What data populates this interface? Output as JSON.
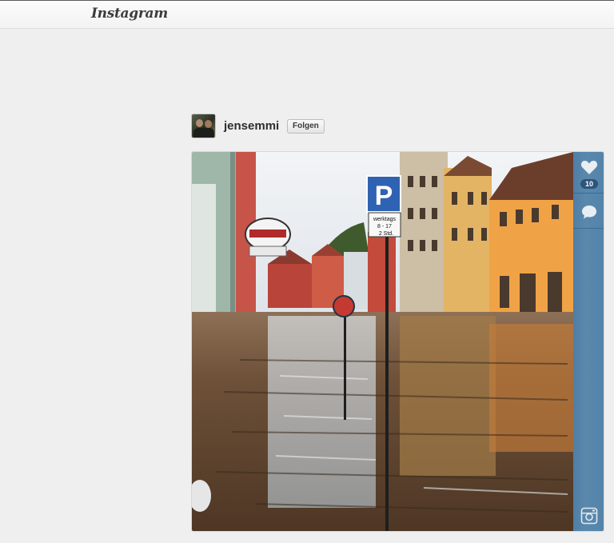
{
  "header": {
    "logo": "Instagram"
  },
  "post": {
    "username": "jensemmi",
    "follow_label": "Folgen",
    "likes": "10"
  },
  "photo": {
    "signs": {
      "parking": "P",
      "time_sign_line1": "werktags",
      "time_sign_line2": "8 - 17",
      "time_sign_line3": "2 Std."
    }
  },
  "icons": [
    "heart-icon",
    "comment-icon",
    "instagram-camera-icon"
  ],
  "colors": {
    "sidebar": "#5283aa",
    "accent": "#2e5479",
    "background": "#efefef"
  }
}
